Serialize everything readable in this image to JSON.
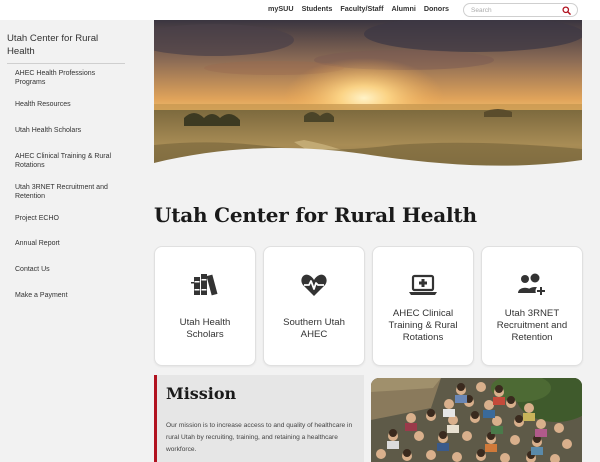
{
  "topbar": {
    "links": [
      "mySUU",
      "Students",
      "Faculty/Staff",
      "Alumni",
      "Donors"
    ],
    "search_placeholder": "Search",
    "search_icon": "search-icon",
    "accent": "#b1121f"
  },
  "sidebar": {
    "title": "Utah Center for Rural Health",
    "items": [
      {
        "label": "AHEC Health Professions Programs"
      },
      {
        "label": "Health Resources"
      },
      {
        "label": "Utah Health Scholars"
      },
      {
        "label": "AHEC Clinical Training & Rural Rotations"
      },
      {
        "label": "Utah 3RNET Recruitment and Retention"
      },
      {
        "label": "Project ECHO"
      },
      {
        "label": "Annual Report"
      },
      {
        "label": "Contact Us"
      },
      {
        "label": "Make a Payment"
      }
    ]
  },
  "main": {
    "title": "Utah Center for Rural Health",
    "cards": [
      {
        "label": "Utah Health Scholars",
        "icon": "books-icon"
      },
      {
        "label": "Southern Utah AHEC",
        "icon": "heartbeat-icon"
      },
      {
        "label": "AHEC Clinical Training & Rural Rotations",
        "icon": "laptop-medical-icon"
      },
      {
        "label": "Utah 3RNET Recruitment and Retention",
        "icon": "users-plus-icon"
      }
    ],
    "mission": {
      "heading": "Mission",
      "text": "Our mission is to increase access to and quality of healthcare in rural Utah by recruiting, training, and retaining a healthcare workforce."
    }
  }
}
